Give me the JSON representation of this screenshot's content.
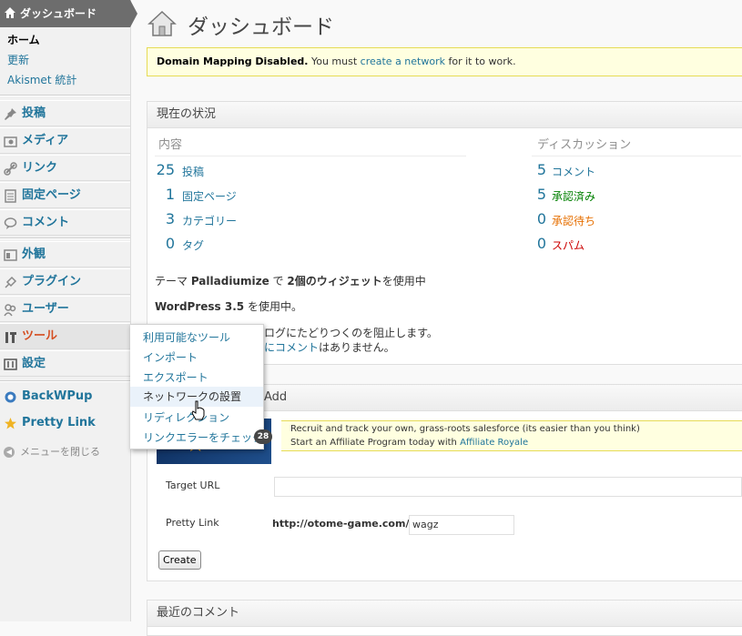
{
  "sidebar": {
    "header": "ダッシュボード",
    "sub": [
      "ホーム",
      "更新",
      "Akismet 統計"
    ],
    "menu": [
      {
        "label": "投稿",
        "icon": "pin-icon"
      },
      {
        "label": "メディア",
        "icon": "media-icon"
      },
      {
        "label": "リンク",
        "icon": "link-icon"
      },
      {
        "label": "固定ページ",
        "icon": "page-icon"
      },
      {
        "label": "コメント",
        "icon": "comment-icon"
      },
      {
        "label": "外観",
        "icon": "appearance-icon"
      },
      {
        "label": "プラグイン",
        "icon": "plugin-icon"
      },
      {
        "label": "ユーザー",
        "icon": "users-icon"
      },
      {
        "label": "ツール",
        "icon": "tools-icon"
      },
      {
        "label": "設定",
        "icon": "settings-icon"
      },
      {
        "label": "BackWPup",
        "icon": "backwpup-icon"
      },
      {
        "label": "Pretty Link",
        "icon": "star-icon"
      }
    ],
    "collapse": "メニューを閉じる"
  },
  "page": {
    "title": "ダッシュボード",
    "notice_bold": "Domain Mapping Disabled.",
    "notice_pre": " You must ",
    "notice_link": "create a network",
    "notice_post": " for it to work."
  },
  "now": {
    "title": "現在の状況",
    "content_head": "内容",
    "discussion_head": "ディスカッション",
    "content": [
      {
        "count": "25",
        "label": "投稿"
      },
      {
        "count": "1",
        "label": "固定ページ"
      },
      {
        "count": "3",
        "label": "カテゴリー"
      },
      {
        "count": "0",
        "label": "タグ"
      }
    ],
    "discussion": [
      {
        "count": "5",
        "label": "コメント"
      },
      {
        "count": "5",
        "label": "承認済み"
      },
      {
        "count": "0",
        "label": "承認待ち"
      },
      {
        "count": "0",
        "label": "スパム"
      }
    ],
    "theme_pre": "テーマ ",
    "theme_name": "Palladiumize",
    "theme_mid": " で ",
    "theme_widgets": "2個のウィジェット",
    "theme_post": "を使用中",
    "wp_pre": "WordPress 3.5",
    "wp_post": " を使用中。",
    "akismet_line": "ログにたどりつくのを阻止します。",
    "akismet_link": "にコメント",
    "akismet_post": "はありません。"
  },
  "prettylink": {
    "title_tail": "Add",
    "promo_1": "Recruit and track your own, grass-roots salesforce (its easier than you think)",
    "promo_2_pre": "Start an Affiliate Program today with ",
    "promo_2_link": "Affiliate Royale",
    "target_label": "Target URL",
    "target_value": "",
    "pretty_label": "Pretty Link",
    "prefix": "http://otome-game.com/",
    "slug": "wagz",
    "create": "Create"
  },
  "recent": {
    "title": "最近のコメント"
  },
  "flyout": {
    "items": [
      "利用可能なツール",
      "インポート",
      "エクスポート",
      "ネットワークの設置",
      "リディレクション",
      "リンクエラーをチェック"
    ],
    "badge": "28"
  },
  "colors": {
    "link": "#21759b",
    "active": "#d54e21",
    "notice_bg": "#ffffe0"
  }
}
